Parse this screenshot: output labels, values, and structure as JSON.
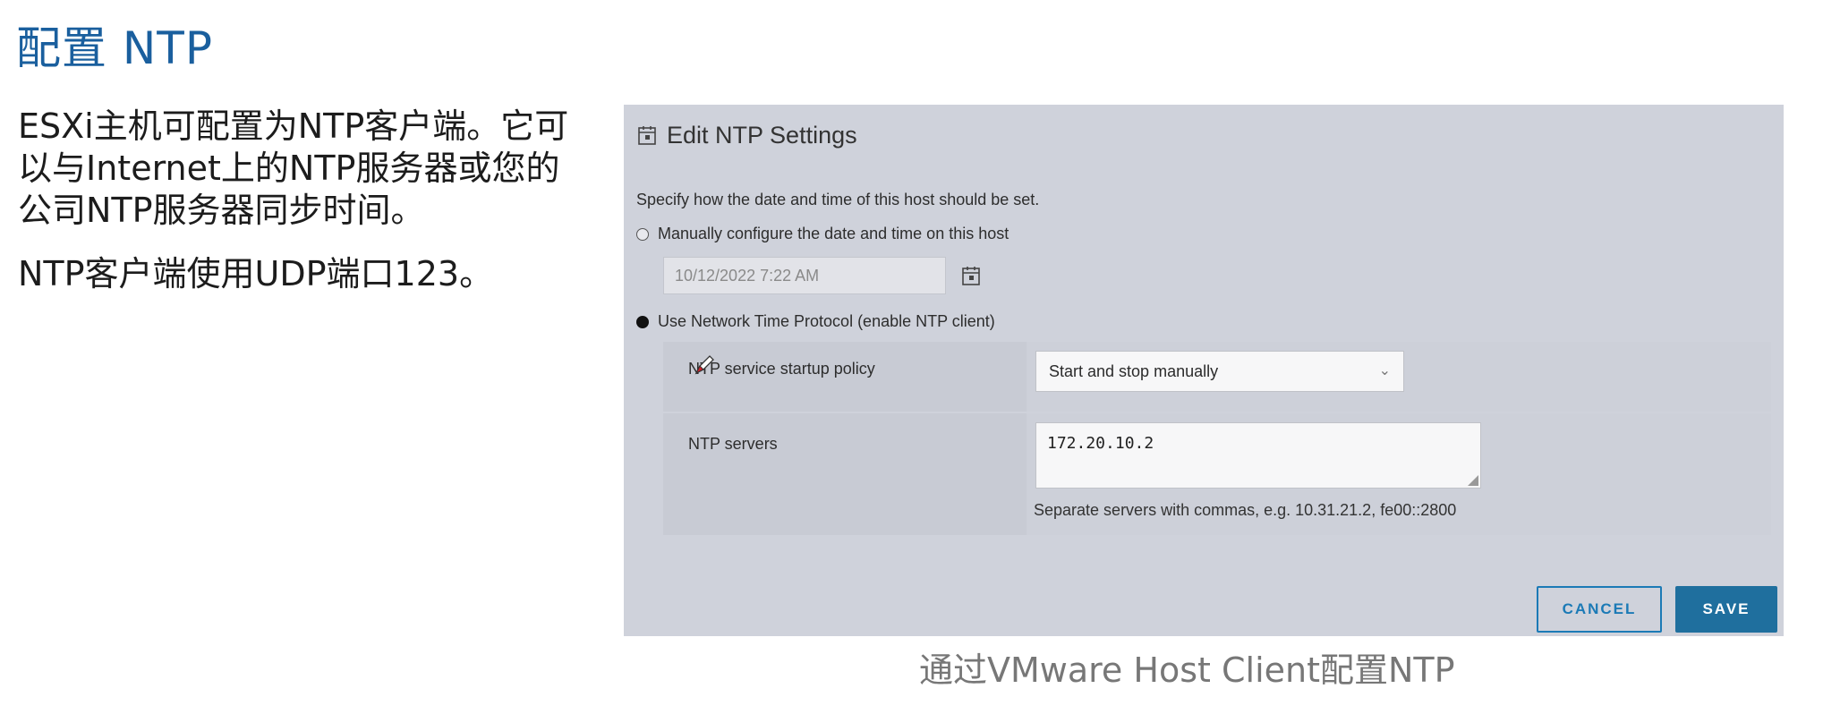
{
  "slide": {
    "title": "配置 NTP",
    "bullets": [
      "ESXi主机可配置为NTP客户端。它可以与Internet上的NTP服务器或您的公司NTP服务器同步时间。",
      "NTP客户端使用UDP端口123。"
    ],
    "caption": "通过VMware Host Client配置NTP"
  },
  "dialog": {
    "title": "Edit NTP Settings",
    "description": "Specify how the date and time of this host should be set.",
    "option_manual": "Manually configure the date and time on this host",
    "manual_datetime": "10/12/2022 7:22 AM",
    "option_ntp": "Use Network Time Protocol (enable NTP client)",
    "selected_option": "ntp",
    "startup_policy_label": "NTP service startup policy",
    "startup_policy_value": "Start and stop manually",
    "servers_label": "NTP servers",
    "servers_value": "172.20.10.2",
    "servers_hint": "Separate servers with commas, e.g. 10.31.21.2, fe00::2800",
    "cancel_label": "CANCEL",
    "save_label": "SAVE"
  },
  "colors": {
    "title_blue": "#1a5f9e",
    "dialog_bg": "#cfd2db",
    "primary_button": "#1f6f9e",
    "secondary_button_border": "#1b7ab6"
  }
}
